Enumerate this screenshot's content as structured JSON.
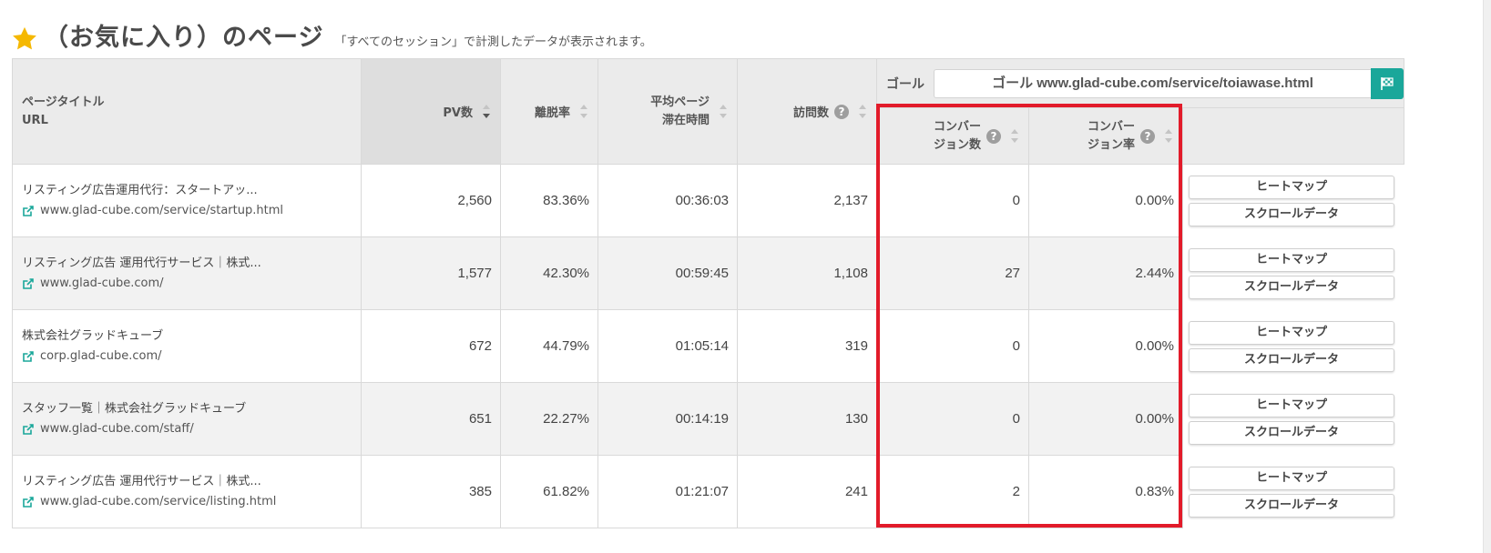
{
  "header": {
    "title": "（お気に入り）のページ",
    "subtitle": "「すべてのセッション」で計測したデータが表示されます。"
  },
  "icons": {
    "star": "star-icon",
    "help": "help-circle-icon",
    "sort": "sort-arrows-icon",
    "goal_button": "checkered-flag-icon",
    "link": "external-link-icon"
  },
  "colors": {
    "accent": "#1aa79a",
    "star": "#f5b800",
    "highlight": "#e21b2a"
  },
  "columns": {
    "page_title": "ページタイトル",
    "url": "URL",
    "pv": "PV数",
    "bounce": "離脱率",
    "avg_time_line1": "平均ページ",
    "avg_time_line2": "滞在時間",
    "visits": "訪問数",
    "conv_count_line1": "コンバー",
    "conv_count_line2": "ジョン数",
    "conv_rate_line1": "コンバー",
    "conv_rate_line2": "ジョン率",
    "help_glyph": "?"
  },
  "goal": {
    "label": "ゴール",
    "value": "ゴール www.glad-cube.com/service/toiawase.html"
  },
  "actions": {
    "heatmap": "ヒートマップ",
    "scroll": "スクロールデータ"
  },
  "rows": [
    {
      "title": "リスティング広告運用代行：スタートアッ...",
      "url": "www.glad-cube.com/service/startup.html",
      "pv": "2,560",
      "bounce": "83.36%",
      "avg_time": "00:36:03",
      "visits": "2,137",
      "conv_count": "0",
      "conv_rate": "0.00%"
    },
    {
      "title": "リスティング広告 運用代行サービス｜株式...",
      "url": "www.glad-cube.com/",
      "pv": "1,577",
      "bounce": "42.30%",
      "avg_time": "00:59:45",
      "visits": "1,108",
      "conv_count": "27",
      "conv_rate": "2.44%"
    },
    {
      "title": "株式会社グラッドキューブ",
      "url": "corp.glad-cube.com/",
      "pv": "672",
      "bounce": "44.79%",
      "avg_time": "01:05:14",
      "visits": "319",
      "conv_count": "0",
      "conv_rate": "0.00%"
    },
    {
      "title": "スタッフ一覧｜株式会社グラッドキューブ",
      "url": "www.glad-cube.com/staff/",
      "pv": "651",
      "bounce": "22.27%",
      "avg_time": "00:14:19",
      "visits": "130",
      "conv_count": "0",
      "conv_rate": "0.00%"
    },
    {
      "title": "リスティング広告 運用代行サービス｜株式...",
      "url": "www.glad-cube.com/service/listing.html",
      "pv": "385",
      "bounce": "61.82%",
      "avg_time": "01:21:07",
      "visits": "241",
      "conv_count": "2",
      "conv_rate": "0.83%"
    }
  ]
}
